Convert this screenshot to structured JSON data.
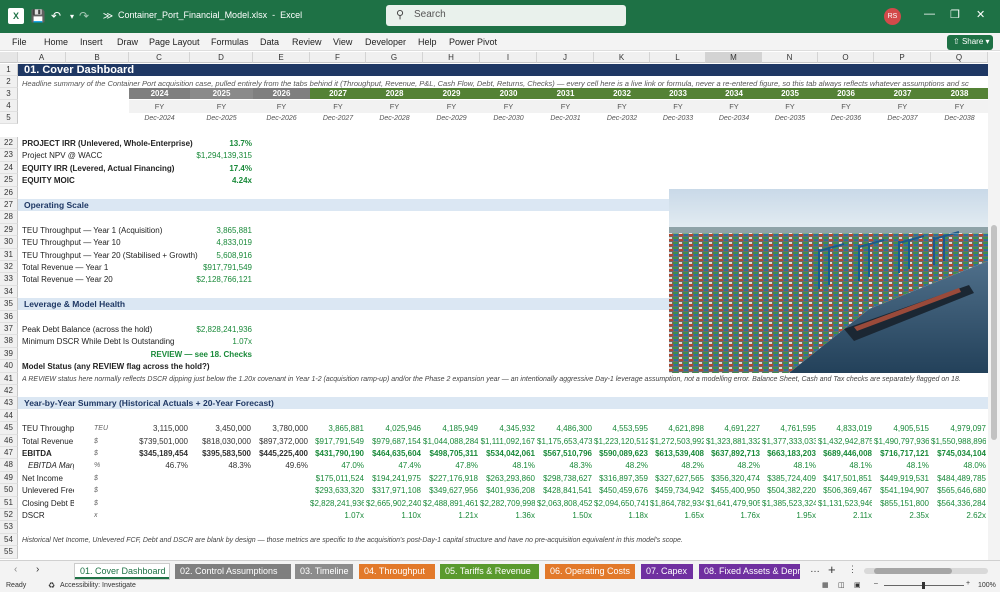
{
  "window": {
    "file_title": "Container_Port_Financial_Model.xlsx",
    "app_name": "Excel",
    "search_placeholder": "Search",
    "user_initials": "RS"
  },
  "menu": [
    "File",
    "Home",
    "Insert",
    "Draw",
    "Page Layout",
    "Formulas",
    "Data",
    "Review",
    "View",
    "Developer",
    "Help",
    "Power Pivot"
  ],
  "share_label": "Share",
  "columns": [
    "A",
    "B",
    "C",
    "D",
    "E",
    "F",
    "G",
    "H",
    "I",
    "J",
    "K",
    "L",
    "M",
    "N",
    "O",
    "P",
    "Q"
  ],
  "sheet": {
    "title": "01. Cover Dashboard",
    "intro": "Headline summary of the Container Port acquisition case, pulled entirely from the tabs behind it (Throughput, Revenue, P&L, Cash Flow, Debt, Returns, Checks) — every cell here is a live link or formula, never a re-entered figure, so this tab always reflects whatever assumptions and sc",
    "years": [
      "2024",
      "2025",
      "2026",
      "2027",
      "2028",
      "2029",
      "2030",
      "2031",
      "2032",
      "2033",
      "2034",
      "2035",
      "2036",
      "2037",
      "2038"
    ],
    "period_type": [
      "",
      "",
      "",
      "FY",
      "FY",
      "FY",
      "FY",
      "FY",
      "FY",
      "FY",
      "FY",
      "FY",
      "FY",
      "FY",
      "FY"
    ],
    "fy_labels": [
      "FY",
      "FY",
      "FY",
      "FY",
      "FY",
      "FY",
      "FY",
      "FY",
      "FY",
      "FY",
      "FY",
      "FY",
      "FY",
      "FY",
      "FY"
    ],
    "period_end": [
      "Dec-2024",
      "Dec-2025",
      "Dec-2026",
      "Dec-2027",
      "Dec-2028",
      "Dec-2029",
      "Dec-2030",
      "Dec-2031",
      "Dec-2032",
      "Dec-2033",
      "Dec-2034",
      "Dec-2035",
      "Dec-2036",
      "Dec-2037",
      "Dec-2038"
    ],
    "headline": [
      {
        "label": "PROJECT IRR (Unlevered, Whole-Enterprise)",
        "value": "13.7%",
        "bold": true
      },
      {
        "label": "Project NPV @ WACC",
        "value": "$1,294,139,315",
        "bold": false
      },
      {
        "label": "EQUITY IRR (Levered, Actual Financing)",
        "value": "17.4%",
        "bold": true
      },
      {
        "label": "EQUITY MOIC",
        "value": "4.24x",
        "bold": true
      }
    ],
    "operating_scale_title": "Operating Scale",
    "operating_scale": [
      {
        "label": "TEU Throughput — Year 1 (Acquisition)",
        "value": "3,865,881"
      },
      {
        "label": "TEU Throughput — Year 10",
        "value": "4,833,019"
      },
      {
        "label": "TEU Throughput — Year 20 (Stabilised + Growth)",
        "value": "5,608,916"
      },
      {
        "label": "Total Revenue — Year 1",
        "value": "$917,791,549"
      },
      {
        "label": "Total Revenue — Year 20",
        "value": "$2,128,766,121"
      }
    ],
    "leverage_title": "Leverage & Model Health",
    "leverage": [
      {
        "label": "Peak Debt Balance (across the hold)",
        "value": "$2,828,241,936"
      },
      {
        "label": "Minimum DSCR While Debt Is Outstanding",
        "value": "1.07x"
      }
    ],
    "review_text": "REVIEW — see 18. Checks",
    "model_status_label": "Model Status (any REVIEW flag across the hold?)",
    "review_note": "A REVIEW status here normally reflects DSCR dipping just below the 1.20x covenant in Year 1-2 (acquisition ramp-up) and/or the Phase 2 expansion year — an intentionally aggressive Day-1 leverage assumption, not a modelling error. Balance Sheet, Cash and Tax checks are separately flagged on 18.",
    "yoy_title": "Year-by-Year Summary (Historical Actuals + 20-Year Forecast)",
    "yoy_rows": [
      {
        "label": "TEU Throughput",
        "unit": "TEU",
        "bold": false,
        "ital": false,
        "values": [
          "3,115,000",
          "3,450,000",
          "3,780,000",
          "3,865,881",
          "4,025,946",
          "4,185,949",
          "4,345,932",
          "4,486,300",
          "4,553,595",
          "4,621,898",
          "4,691,227",
          "4,761,595",
          "4,833,019",
          "4,905,515",
          "4,979,097"
        ]
      },
      {
        "label": "Total Revenue",
        "unit": "$",
        "bold": false,
        "ital": false,
        "values": [
          "$739,501,000",
          "$818,030,000",
          "$897,372,000",
          "$917,791,549",
          "$979,687,154",
          "$1,044,088,284",
          "$1,111,092,167",
          "$1,175,653,473",
          "$1,223,120,512",
          "$1,272,503,992",
          "$1,323,881,332",
          "$1,377,333,033",
          "$1,432,942,875",
          "$1,490,797,936",
          "$1,550,988,896"
        ]
      },
      {
        "label": "EBITDA",
        "unit": "$",
        "bold": true,
        "ital": false,
        "values": [
          "$345,189,454",
          "$395,583,500",
          "$445,225,400",
          "$431,790,190",
          "$464,635,604",
          "$498,705,311",
          "$534,042,061",
          "$567,510,796",
          "$590,089,623",
          "$613,539,408",
          "$637,892,713",
          "$663,183,203",
          "$689,446,008",
          "$716,717,121",
          "$745,034,104"
        ]
      },
      {
        "label": "EBITDA Margin",
        "unit": "%",
        "bold": false,
        "ital": true,
        "values": [
          "46.7%",
          "48.3%",
          "49.6%",
          "47.0%",
          "47.4%",
          "47.8%",
          "48.1%",
          "48.3%",
          "48.2%",
          "48.2%",
          "48.2%",
          "48.1%",
          "48.1%",
          "48.1%",
          "48.0%"
        ]
      },
      {
        "label": "Net Income",
        "unit": "$",
        "bold": false,
        "ital": false,
        "values": [
          "",
          "",
          "",
          "$175,011,524",
          "$194,241,975",
          "$227,176,918",
          "$263,293,860",
          "$298,738,627",
          "$316,897,359",
          "$327,627,565",
          "$356,320,474",
          "$385,724,409",
          "$417,501,851",
          "$449,919,531",
          "$484,489,785"
        ]
      },
      {
        "label": "Unlevered Free Cash Flow",
        "unit": "$",
        "bold": false,
        "ital": false,
        "values": [
          "",
          "",
          "",
          "$293,633,320",
          "$317,971,108",
          "$349,627,956",
          "$401,936,208",
          "$428,841,541",
          "$450,459,676",
          "$459,734,942",
          "$455,400,950",
          "$504,382,220",
          "$506,369,467",
          "$541,194,907",
          "$565,646,680"
        ]
      },
      {
        "label": "Closing Debt Balance",
        "unit": "$",
        "bold": false,
        "ital": false,
        "values": [
          "",
          "",
          "",
          "$2,828,241,936",
          "$2,665,902,240",
          "$2,488,891,461",
          "$2,282,709,998",
          "$2,063,808,452",
          "$2,094,650,741",
          "$1,864,782,934",
          "$1,641,479,905",
          "$1,385,523,324",
          "$1,131,523,946",
          "$855,151,800",
          "$564,336,284"
        ]
      },
      {
        "label": "DSCR",
        "unit": "x",
        "bold": false,
        "ital": false,
        "values": [
          "",
          "",
          "",
          "1.07x",
          "1.10x",
          "1.21x",
          "1.36x",
          "1.50x",
          "1.18x",
          "1.65x",
          "1.76x",
          "1.95x",
          "2.11x",
          "2.35x",
          "2.62x"
        ]
      }
    ],
    "footnote": "Historical Net Income, Unlevered FCF, Debt and DSCR are blank by design — those metrics are specific to the acquisition's post-Day-1 capital structure and have no pre-acquisition equivalent in this model's scope."
  },
  "row_numbers": [
    "1",
    "2",
    "3",
    "4",
    "5",
    "22",
    "23",
    "24",
    "25",
    "26",
    "27",
    "28",
    "29",
    "30",
    "31",
    "32",
    "33",
    "34",
    "35",
    "36",
    "37",
    "38",
    "39",
    "40",
    "41",
    "42",
    "43",
    "44",
    "45",
    "46",
    "47",
    "48",
    "49",
    "50",
    "51",
    "52",
    "53",
    "54",
    "55"
  ],
  "tabs": [
    {
      "label": "01. Cover Dashboard",
      "color": "#ffffff",
      "text": "#1e7145",
      "active": true
    },
    {
      "label": "02. Control Assumptions",
      "color": "#7f7f7f",
      "text": "#ffffff",
      "active": false
    },
    {
      "label": "03. Timeline",
      "color": "#8c8c8c",
      "text": "#ffffff",
      "active": false
    },
    {
      "label": "04. Throughput",
      "color": "#e2792a",
      "text": "#ffffff",
      "active": false
    },
    {
      "label": "05. Tariffs & Revenue",
      "color": "#5a9a2e",
      "text": "#ffffff",
      "active": false
    },
    {
      "label": "06. Operating Costs",
      "color": "#e2792a",
      "text": "#ffffff",
      "active": false
    },
    {
      "label": "07. Capex",
      "color": "#7030a0",
      "text": "#ffffff",
      "active": false
    },
    {
      "label": "08. Fixed Assets & Depr",
      "color": "#7030a0",
      "text": "#ffffff",
      "active": false
    }
  ],
  "status": {
    "ready": "Ready",
    "accessibility": "Accessibility: Investigate",
    "zoom": "100%"
  },
  "colors": {
    "excel_green": "#1e7145",
    "section_fill": "#dbe7f3",
    "historical_band": "#7f7f7f",
    "forecast_band": "#548235",
    "title_band": "#1f3864"
  }
}
